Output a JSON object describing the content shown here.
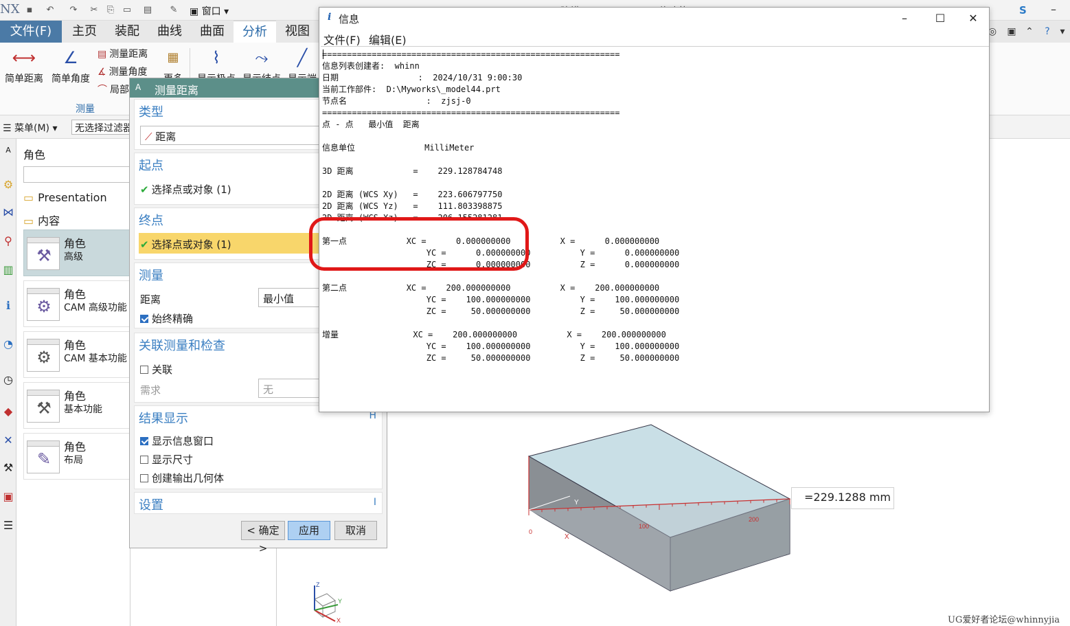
{
  "app": {
    "title": "NX 12 - 建模 - [model44.prt (修改的)]",
    "logo": "NX",
    "window_menu": "窗口",
    "right_badge": "S"
  },
  "tabs": {
    "file": "文件(F)",
    "items": [
      "主页",
      "装配",
      "曲线",
      "曲面",
      "分析",
      "视图"
    ],
    "active": "分析"
  },
  "ribbon": {
    "simple_distance": "简单距离",
    "simple_angle": "简单角度",
    "measure_distance": "测量距离",
    "measure_angle": "测量角度",
    "local": "局部",
    "more": "更多",
    "display_1": "显示极点",
    "display_2": "显示结点",
    "display_3": "显示端",
    "group_label": "测量"
  },
  "menubar": {
    "menu": "菜单(M)",
    "filter": "无选择过滤器"
  },
  "role_navigator": {
    "heading": "角色",
    "folders": [
      "Presentation",
      "内容"
    ],
    "roles": [
      {
        "title": "角色",
        "subtitle": "高级",
        "icon": "tools-icon"
      },
      {
        "title": "角色",
        "subtitle": "CAM 高级功能",
        "icon": "cam-advanced-icon"
      },
      {
        "title": "角色",
        "subtitle": "CAM 基本功能",
        "icon": "cam-basic-icon"
      },
      {
        "title": "角色",
        "subtitle": "基本功能",
        "icon": "tools-icon"
      },
      {
        "title": "角色",
        "subtitle": "布局",
        "icon": "layout-icon"
      }
    ]
  },
  "measure_dialog": {
    "title": "测量距离",
    "type_section": "类型",
    "type_value": "距离",
    "start_section": "起点",
    "start_value": "选择点或对象 (1)",
    "end_section": "终点",
    "end_value": "选择点或对象 (1)",
    "measure_section": "测量",
    "distance_label": "距离",
    "distance_value": "最小值",
    "always_exact": "始终精确",
    "assoc_section": "关联测量和检查",
    "assoc_label": "关联",
    "requirement_label": "需求",
    "requirement_value": "无",
    "results_section": "结果显示",
    "results_key": "H",
    "show_info_window": "显示信息窗口",
    "show_dimension": "显示尺寸",
    "create_output_geometry": "创建输出几何体",
    "settings_section": "设置",
    "settings_key": "I",
    "ok_button": "< 确定 >",
    "apply_button": "应用",
    "cancel_button": "取消",
    "always_exact_checked": true,
    "assoc_checked": false,
    "show_info_window_checked": true,
    "show_dimension_checked": false,
    "create_output_geometry_checked": false
  },
  "info_window": {
    "title": "信息",
    "menu_file": "文件(F)",
    "menu_edit": "编辑(E)",
    "content": "============================================================\n信息列表创建者:  whinn\n日期                :  2024/10/31 9:00:30\n当前工作部件:  D:\\Myworks\\_model44.prt\n节点名                :  zjsj-0\n============================================================\n点 - 点   最小值  距离\n\n信息单位              MilliMeter\n\n3D 距离            =    229.128784748\n\n2D 距离 (WCS Xy)   =    223.606797750\n2D 距离 (WCS Yz)   =    111.803398875\n2D 距离 (WCS Xz)   =    206.155281281\n\n第一点            XC =      0.000000000          X =      0.000000000\n                     YC =      0.000000000          Y =      0.000000000\n                     ZC =      0.000000000          Z =      0.000000000\n\n第二点            XC =    200.000000000          X =    200.000000000\n                     YC =    100.000000000          Y =    100.000000000\n                     ZC =     50.000000000          Z =     50.000000000\n\n增量               XC =    200.000000000          X =    200.000000000\n                     YC =    100.000000000          Y =    100.000000000\n                     ZC =     50.000000000          Z =     50.000000000"
  },
  "graphics": {
    "measure_result": "=229.1288 mm",
    "ruler_labels": [
      "0",
      "100",
      "200"
    ],
    "axis_labels": [
      "Y",
      "X",
      "Z"
    ],
    "triad_labels": [
      "Z",
      "X",
      "Y"
    ],
    "watermark": "UG爱好者论坛@whinnyjia"
  },
  "colors": {
    "file_tab": "#4b7aa6",
    "dialog_header": "#5c8f89",
    "section_title": "#3b7fc2",
    "highlight": "#f8d66b",
    "annotation_red": "#e01818",
    "block_top": "#c9dfe6",
    "block_side": "#8a8f94"
  }
}
